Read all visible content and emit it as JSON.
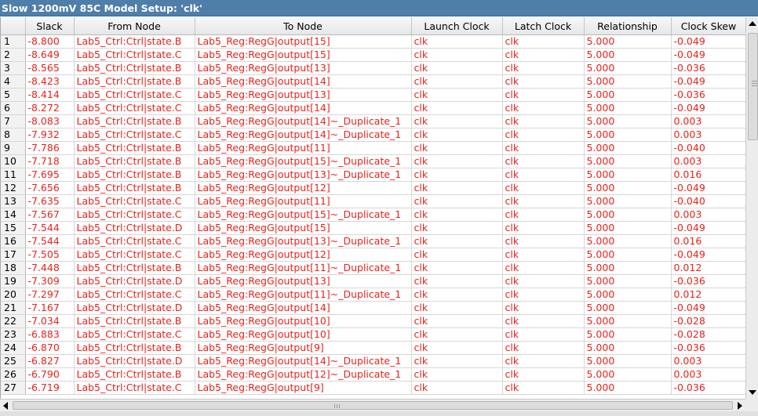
{
  "window": {
    "title": "Slow 1200mV 85C Model Setup: 'clk'"
  },
  "table": {
    "columns": [
      "",
      "Slack",
      "From Node",
      "To Node",
      "Launch Clock",
      "Latch Clock",
      "Relationship",
      "Clock Skew"
    ],
    "rows": [
      [
        "1",
        "-8.800",
        "Lab5_Ctrl:Ctrl|state.B",
        "Lab5_Reg:RegG|output[15]",
        "clk",
        "clk",
        "5.000",
        "-0.049"
      ],
      [
        "2",
        "-8.649",
        "Lab5_Ctrl:Ctrl|state.C",
        "Lab5_Reg:RegG|output[15]",
        "clk",
        "clk",
        "5.000",
        "-0.049"
      ],
      [
        "3",
        "-8.565",
        "Lab5_Ctrl:Ctrl|state.B",
        "Lab5_Reg:RegG|output[13]",
        "clk",
        "clk",
        "5.000",
        "-0.036"
      ],
      [
        "4",
        "-8.423",
        "Lab5_Ctrl:Ctrl|state.B",
        "Lab5_Reg:RegG|output[14]",
        "clk",
        "clk",
        "5.000",
        "-0.049"
      ],
      [
        "5",
        "-8.414",
        "Lab5_Ctrl:Ctrl|state.C",
        "Lab5_Reg:RegG|output[13]",
        "clk",
        "clk",
        "5.000",
        "-0.036"
      ],
      [
        "6",
        "-8.272",
        "Lab5_Ctrl:Ctrl|state.C",
        "Lab5_Reg:RegG|output[14]",
        "clk",
        "clk",
        "5.000",
        "-0.049"
      ],
      [
        "7",
        "-8.083",
        "Lab5_Ctrl:Ctrl|state.B",
        "Lab5_Reg:RegG|output[14]~_Duplicate_1",
        "clk",
        "clk",
        "5.000",
        "0.003"
      ],
      [
        "8",
        "-7.932",
        "Lab5_Ctrl:Ctrl|state.C",
        "Lab5_Reg:RegG|output[14]~_Duplicate_1",
        "clk",
        "clk",
        "5.000",
        "0.003"
      ],
      [
        "9",
        "-7.786",
        "Lab5_Ctrl:Ctrl|state.B",
        "Lab5_Reg:RegG|output[11]",
        "clk",
        "clk",
        "5.000",
        "-0.040"
      ],
      [
        "10",
        "-7.718",
        "Lab5_Ctrl:Ctrl|state.B",
        "Lab5_Reg:RegG|output[15]~_Duplicate_1",
        "clk",
        "clk",
        "5.000",
        "0.003"
      ],
      [
        "11",
        "-7.695",
        "Lab5_Ctrl:Ctrl|state.B",
        "Lab5_Reg:RegG|output[13]~_Duplicate_1",
        "clk",
        "clk",
        "5.000",
        "0.016"
      ],
      [
        "12",
        "-7.656",
        "Lab5_Ctrl:Ctrl|state.B",
        "Lab5_Reg:RegG|output[12]",
        "clk",
        "clk",
        "5.000",
        "-0.049"
      ],
      [
        "13",
        "-7.635",
        "Lab5_Ctrl:Ctrl|state.C",
        "Lab5_Reg:RegG|output[11]",
        "clk",
        "clk",
        "5.000",
        "-0.040"
      ],
      [
        "14",
        "-7.567",
        "Lab5_Ctrl:Ctrl|state.C",
        "Lab5_Reg:RegG|output[15]~_Duplicate_1",
        "clk",
        "clk",
        "5.000",
        "0.003"
      ],
      [
        "15",
        "-7.544",
        "Lab5_Ctrl:Ctrl|state.D",
        "Lab5_Reg:RegG|output[15]",
        "clk",
        "clk",
        "5.000",
        "-0.049"
      ],
      [
        "16",
        "-7.544",
        "Lab5_Ctrl:Ctrl|state.C",
        "Lab5_Reg:RegG|output[13]~_Duplicate_1",
        "clk",
        "clk",
        "5.000",
        "0.016"
      ],
      [
        "17",
        "-7.505",
        "Lab5_Ctrl:Ctrl|state.C",
        "Lab5_Reg:RegG|output[12]",
        "clk",
        "clk",
        "5.000",
        "-0.049"
      ],
      [
        "18",
        "-7.448",
        "Lab5_Ctrl:Ctrl|state.B",
        "Lab5_Reg:RegG|output[11]~_Duplicate_1",
        "clk",
        "clk",
        "5.000",
        "0.012"
      ],
      [
        "19",
        "-7.309",
        "Lab5_Ctrl:Ctrl|state.D",
        "Lab5_Reg:RegG|output[13]",
        "clk",
        "clk",
        "5.000",
        "-0.036"
      ],
      [
        "20",
        "-7.297",
        "Lab5_Ctrl:Ctrl|state.C",
        "Lab5_Reg:RegG|output[11]~_Duplicate_1",
        "clk",
        "clk",
        "5.000",
        "0.012"
      ],
      [
        "21",
        "-7.167",
        "Lab5_Ctrl:Ctrl|state.D",
        "Lab5_Reg:RegG|output[14]",
        "clk",
        "clk",
        "5.000",
        "-0.049"
      ],
      [
        "22",
        "-7.034",
        "Lab5_Ctrl:Ctrl|state.B",
        "Lab5_Reg:RegG|output[10]",
        "clk",
        "clk",
        "5.000",
        "-0.028"
      ],
      [
        "23",
        "-6.883",
        "Lab5_Ctrl:Ctrl|state.C",
        "Lab5_Reg:RegG|output[10]",
        "clk",
        "clk",
        "5.000",
        "-0.028"
      ],
      [
        "24",
        "-6.870",
        "Lab5_Ctrl:Ctrl|state.B",
        "Lab5_Reg:RegG|output[9]",
        "clk",
        "clk",
        "5.000",
        "-0.036"
      ],
      [
        "25",
        "-6.827",
        "Lab5_Ctrl:Ctrl|state.D",
        "Lab5_Reg:RegG|output[14]~_Duplicate_1",
        "clk",
        "clk",
        "5.000",
        "0.003"
      ],
      [
        "26",
        "-6.790",
        "Lab5_Ctrl:Ctrl|state.B",
        "Lab5_Reg:RegG|output[12]~_Duplicate_1",
        "clk",
        "clk",
        "5.000",
        "0.003"
      ],
      [
        "27",
        "-6.719",
        "Lab5_Ctrl:Ctrl|state.C",
        "Lab5_Reg:RegG|output[9]",
        "clk",
        "clk",
        "5.000",
        "-0.036"
      ]
    ]
  },
  "colors": {
    "title_bar": "#4f7ea9",
    "value_text": "#e8231c"
  },
  "icons": {
    "scroll_up": "arrow-up-icon",
    "scroll_down": "arrow-down-icon",
    "scroll_left": "arrow-left-icon",
    "scroll_right": "arrow-right-icon"
  }
}
